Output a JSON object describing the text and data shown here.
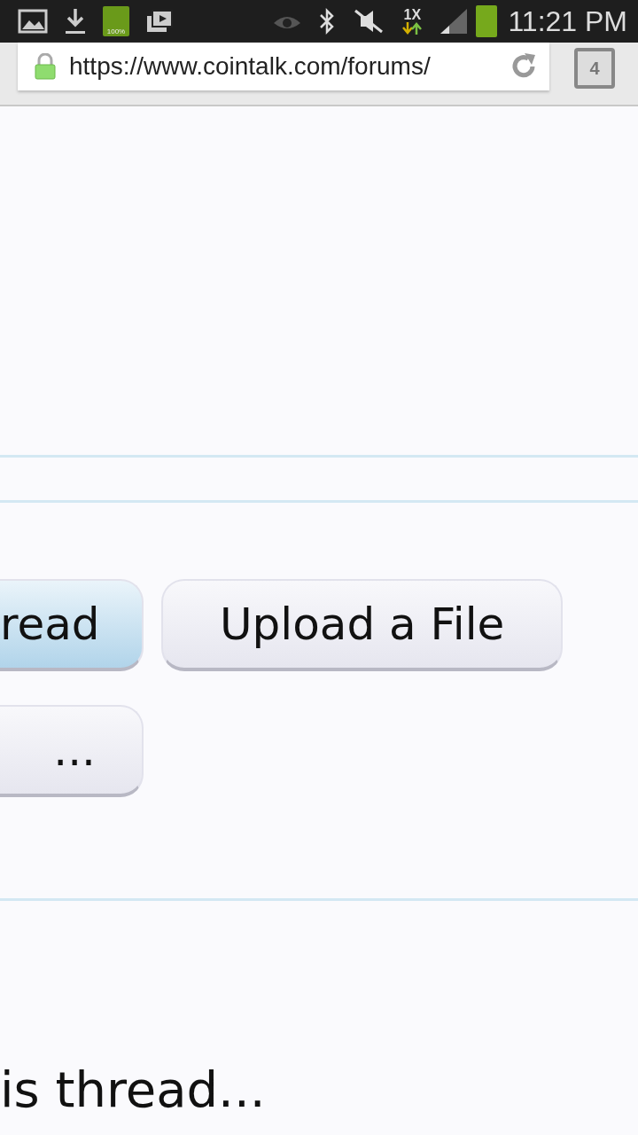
{
  "status_bar": {
    "battery_label": "100%",
    "network_rate": "1X",
    "time": "11:21 PM"
  },
  "address_bar": {
    "url": "https://www.cointalk.com/forums/",
    "tab_count": "4"
  },
  "button_rows": [
    [
      {
        "label": "read",
        "highlighted": true
      },
      {
        "label": "Upload a File",
        "highlighted": false
      }
    ],
    [
      {
        "label": "...",
        "highlighted": false
      }
    ]
  ],
  "footer_text": "is thread..."
}
